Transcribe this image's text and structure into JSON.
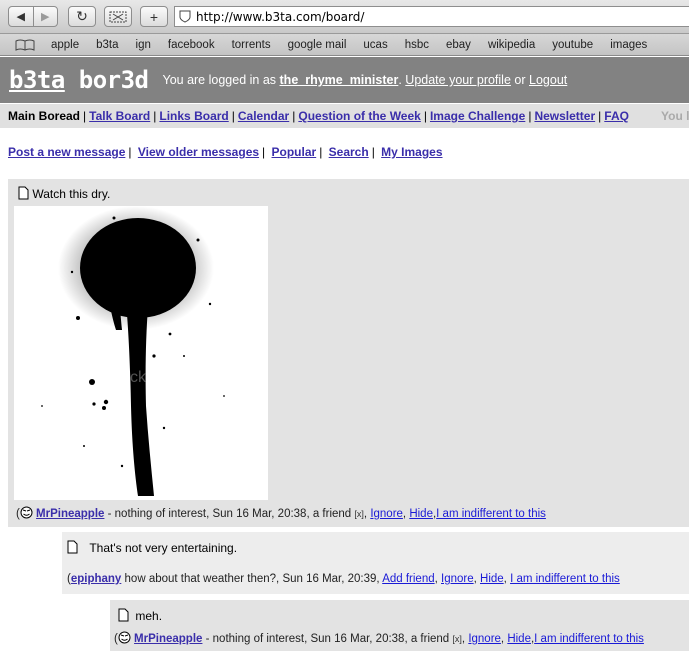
{
  "browser": {
    "url": "http://www.b3ta.com/board/",
    "bookmarks": [
      "apple",
      "b3ta",
      "ign",
      "facebook",
      "torrents",
      "google mail",
      "ucas",
      "hsbc",
      "ebay",
      "wikipedia",
      "youtube",
      "images"
    ]
  },
  "header": {
    "logo_left": "b3ta",
    "logo_right": " bor3d",
    "logged_in_text": "You are logged in as",
    "username": "the_rhyme_minister",
    "update_profile": "Update your profile",
    "or": "or",
    "logout": "Logout"
  },
  "subnav": {
    "current": "Main Boread",
    "links": [
      "Talk Board",
      "Links Board",
      "Calendar",
      "Question of the Week",
      "Image Challenge",
      "Newsletter",
      "FAQ"
    ],
    "right_text": "You l"
  },
  "actions": [
    "Post a new message",
    "View older messages",
    "Popular",
    "Search",
    "My Images"
  ],
  "posts": [
    {
      "body": "Watch this dry.",
      "author": "MrPineapple",
      "meta_text": " - nothing of interest, Sun 16 Mar, 20:38, a friend ",
      "x": "[x]",
      "links": [
        "Ignore",
        "Hide",
        "I am indifferent to this"
      ]
    },
    {
      "body": "That's not very entertaining.",
      "author": "epiphany",
      "meta_text": "  how about that weather then?, Sun 16 Mar, 20:39, ",
      "links": [
        "Add friend",
        "Ignore",
        "Hide",
        "I am indifferent to this"
      ]
    },
    {
      "body": "meh.",
      "author": "MrPineapple",
      "meta_text": " - nothing of interest, Sun 16 Mar, 20:38, a friend ",
      "x": "[x]",
      "links": [
        "Ignore",
        "Hide",
        "I am indifferent to this"
      ]
    }
  ],
  "image": {
    "watermark": "ck"
  }
}
